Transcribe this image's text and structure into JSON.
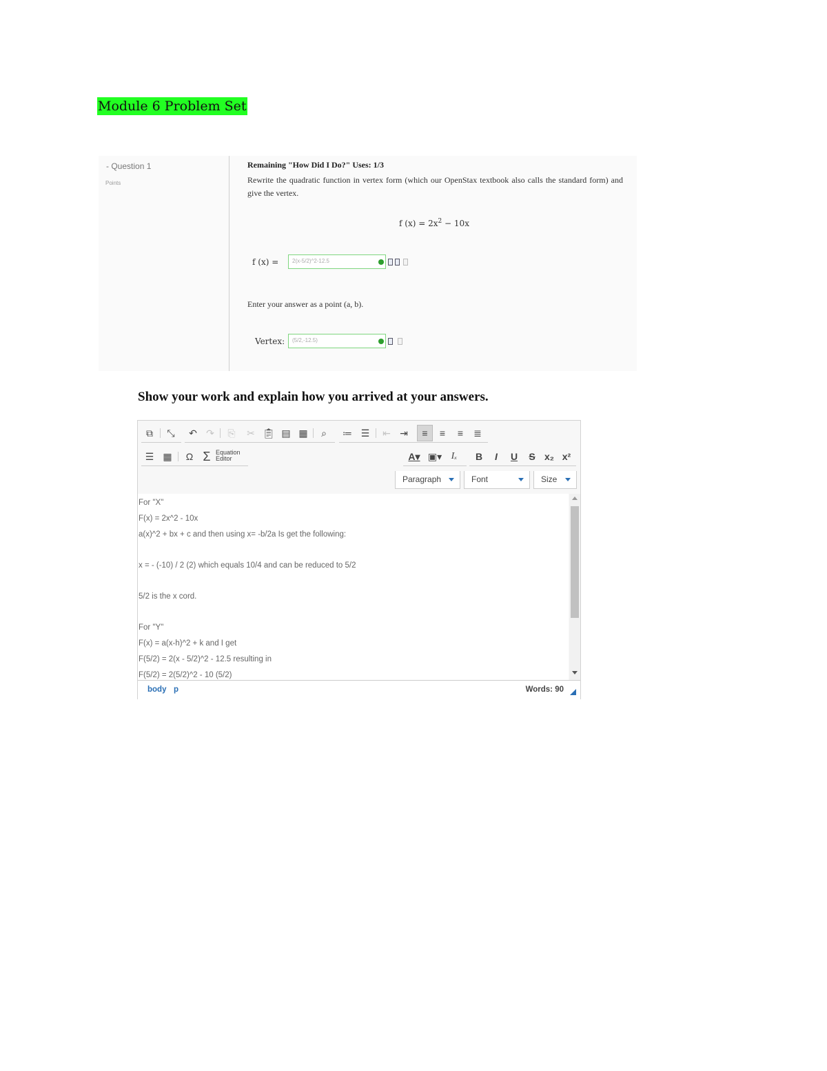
{
  "page": {
    "title": "Module 6 Problem Set"
  },
  "question": {
    "label": "Question 1",
    "points_label": "Points",
    "remaining": "Remaining \"How Did I Do?\" Uses: 1/3",
    "instructions": "Rewrite the quadratic function in vertex form (which our OpenStax textbook also calls the standard form) and give the vertex.",
    "function_lhs": "f (x) = 2x",
    "function_exp": "2",
    "function_rhs": " − 10x",
    "answer1": {
      "label": "f (x) =",
      "value": "2(x-5/2)^2-12.5"
    },
    "point_prompt": "Enter your answer as a point (a, b).",
    "answer2": {
      "label": "Vertex:",
      "value": "(5/2,-12.5)"
    }
  },
  "work_heading": "Show your work and explain how you arrived at your answers.",
  "editor": {
    "toolbar": {
      "equation_editor_label": "Equation Editor",
      "paragraph_label": "Paragraph",
      "font_label": "Font",
      "size_label": "Size"
    },
    "content_lines": [
      "For \"X\"",
      "F(x) = 2x^2 - 10x",
      "a(x)^2 + bx + c and then using x= -b/2a Is get the following:",
      "",
      "x = - (-10) / 2 (2) which equals 10/4 and can be reduced to 5/2",
      "",
      "5/2 is the x cord.",
      "",
      "For \"Y\"",
      "F(x) = a(x-h)^2 + k  and I get",
      "F(5/2) = 2(x - 5/2)^2 - 12.5 resulting in",
      "F(5/2) = 2(5/2)^2 - 10 (5/2)"
    ],
    "status": {
      "path_body": "body",
      "path_p": "p",
      "word_count": "Words: 90"
    }
  }
}
